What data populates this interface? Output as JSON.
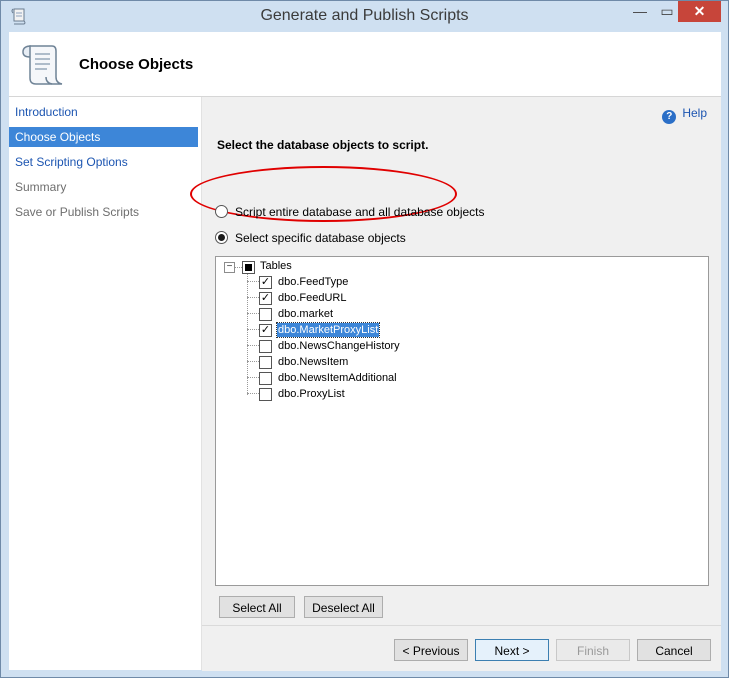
{
  "window": {
    "title": "Generate and Publish Scripts",
    "close_glyph": "✕",
    "min_glyph": "—",
    "max_glyph": "▭"
  },
  "header": {
    "title": "Choose Objects"
  },
  "nav": [
    {
      "label": "Introduction"
    },
    {
      "label": "Choose Objects"
    },
    {
      "label": "Set Scripting Options"
    },
    {
      "label": "Summary"
    },
    {
      "label": "Save or Publish Scripts"
    }
  ],
  "help": {
    "label": "Help",
    "icon_glyph": "?"
  },
  "main": {
    "instruction": "Select the database objects to script.",
    "radio_entire": "Script entire database and all database objects",
    "radio_specific": "Select specific database objects",
    "selected_option": "specific"
  },
  "tree": {
    "root_label": "Tables",
    "expander_glyph": "−",
    "items": [
      {
        "label": "dbo.FeedType",
        "checked": true
      },
      {
        "label": "dbo.FeedURL",
        "checked": true
      },
      {
        "label": "dbo.market",
        "checked": false
      },
      {
        "label": "dbo.MarketProxyList",
        "checked": true,
        "selected": true
      },
      {
        "label": "dbo.NewsChangeHistory",
        "checked": false
      },
      {
        "label": "dbo.NewsItem",
        "checked": false
      },
      {
        "label": "dbo.NewsItemAdditional",
        "checked": false
      },
      {
        "label": "dbo.ProxyList",
        "checked": false
      }
    ]
  },
  "buttons": {
    "select_all": "Select All",
    "deselect_all": "Deselect All",
    "previous": "< Previous",
    "next": "Next >",
    "finish": "Finish",
    "cancel": "Cancel"
  }
}
